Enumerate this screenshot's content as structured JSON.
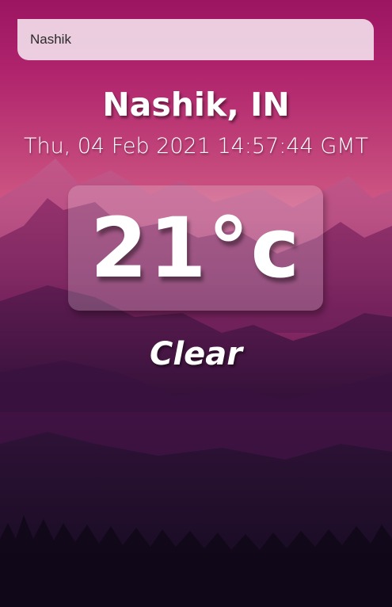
{
  "search": {
    "value": "Nashik"
  },
  "location": {
    "name": "Nashik, IN"
  },
  "date": {
    "text": "Thu, 04 Feb 2021 14:57:44 GMT"
  },
  "temperature": {
    "text": "21°c"
  },
  "weather": {
    "condition": "Clear"
  },
  "colors": {
    "sky_top": "#9e1862",
    "sky_mid": "#b83a7a",
    "horizon": "#d55a86",
    "valley": "#7c1f5c",
    "ground": "#1a0f2c",
    "search_bg": "#f5e6f0"
  },
  "icons": {
    "background": "mountain-landscape-illustration"
  }
}
